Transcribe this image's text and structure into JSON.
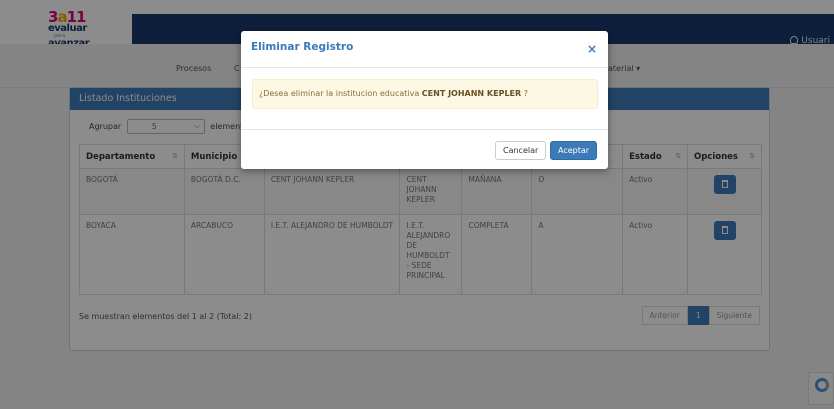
{
  "logo": {
    "line1": "3",
    "line1b": "a",
    "line1c": "11",
    "line2": "evaluar",
    "line3": "para",
    "line4": "avanzar"
  },
  "header": {
    "user_label": "Usuari"
  },
  "menu": {
    "items": [
      "Procesos",
      "C",
      "aterial ▾"
    ]
  },
  "panel": {
    "title": "Listado Instituciones",
    "group_label": "Agrupar",
    "group_value": "5",
    "group_suffix": "elementos",
    "columns": [
      "Departamento",
      "Municipio",
      "",
      "",
      "",
      "",
      "Estado",
      "Opciones"
    ],
    "rows": [
      {
        "departamento": "BOGOTÁ",
        "municipio": "BOGOTÁ D.C.",
        "institucion": "CENT JOHANN KEPLER",
        "sede": "CENT\nJOHANN\nKEPLER",
        "jornada": "MAÑANA",
        "codigo": "O",
        "estado": "Activo"
      },
      {
        "departamento": "BOYACA",
        "municipio": "ARCABUCO",
        "institucion": "I.E.T. ALEJANDRO DE HUMBOLDT",
        "sede": "I.E.T.\nALEJANDRO\nDE\nHUMBOLDT\n- SEDE\nPRINCIPAL",
        "jornada": "COMPLETA",
        "codigo": "A",
        "estado": "Activo"
      }
    ],
    "showing": "Se muestran elementos del 1 al 2 (Total: 2)",
    "pager": {
      "prev": "Anterior",
      "current": "1",
      "next": "Siguiente"
    }
  },
  "modal": {
    "title": "Eliminar Registro",
    "close": "×",
    "message_prefix": "¿Desea eliminar la institucion educativa ",
    "message_name": "CENT JOHANN KEPLER",
    "message_suffix": " ?",
    "cancel_label": "Cancelar",
    "accept_label": "Aceptar"
  },
  "colors": {
    "navbar": "#1b3a6e",
    "primary": "#3c7ab8",
    "warning_bg": "#fcf8e3"
  }
}
